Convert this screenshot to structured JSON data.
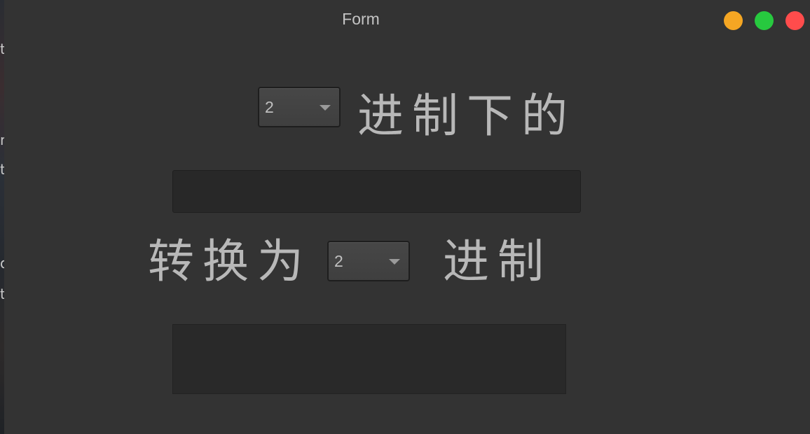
{
  "window": {
    "title": "Form",
    "controls": {
      "minimize_color": "#f5a623",
      "maximize_color": "#27c93f",
      "close_color": "#ff4c4c"
    }
  },
  "desktop_edge_glyphs": [
    "t",
    "n",
    "t",
    "o",
    "t"
  ],
  "form": {
    "from_base": {
      "selected": "2",
      "suffix_label": "进制下的"
    },
    "input_value": "",
    "to_base": {
      "prefix_label": "转换为",
      "selected": "2",
      "suffix_label": "进制"
    },
    "output_value": ""
  }
}
